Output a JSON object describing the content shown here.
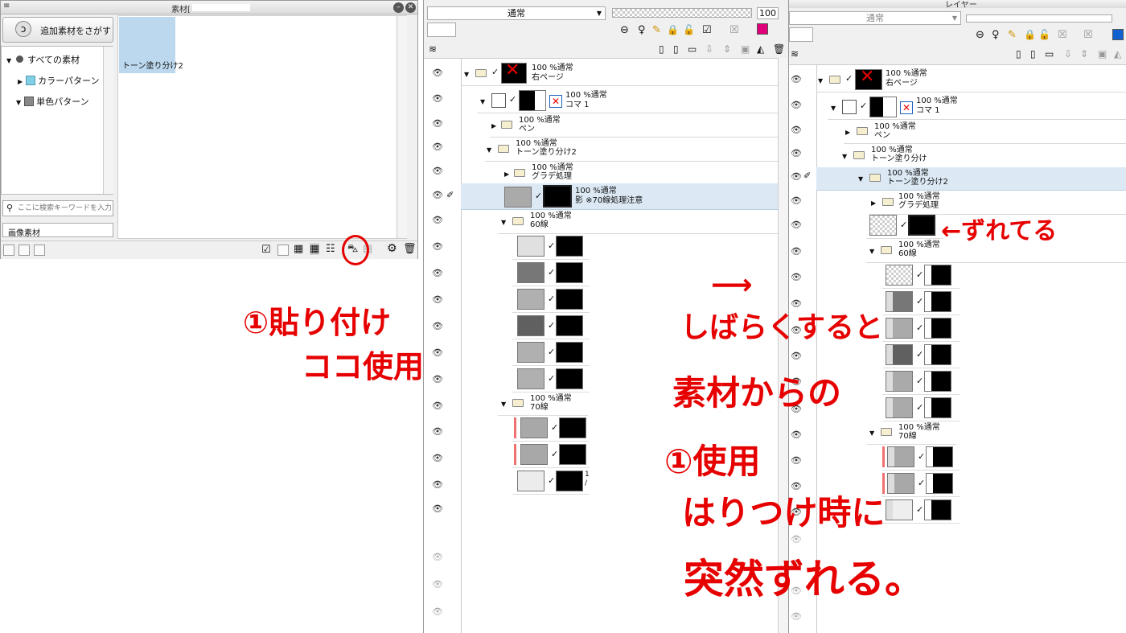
{
  "material_panel": {
    "title": "素材[",
    "add_button": "追加素材をさがす",
    "tree": [
      "すべての素材",
      "カラーパターン",
      "単色パターン"
    ],
    "search_placeholder": "ここに検索キーワードを入力して",
    "category_tab": "画像素材",
    "selected_material": "トーン塗り分け2"
  },
  "middle_panel": {
    "blend_mode": "通常",
    "opacity": "100",
    "layers": [
      {
        "opacity": "100 %通常",
        "name": "右ページ"
      },
      {
        "opacity": "100 %通常",
        "name": "コマ 1"
      },
      {
        "opacity": "100 %通常",
        "name": "ペン"
      },
      {
        "opacity": "100 %通常",
        "name": "トーン塗り分け2"
      },
      {
        "opacity": "100 %通常",
        "name": "グラデ処理"
      },
      {
        "opacity": "100 %通常",
        "name": "影 ※70線処理注意"
      },
      {
        "opacity": "100 %通常",
        "name": "60線"
      },
      {
        "opacity": "100 %通常",
        "name": "70線"
      }
    ],
    "partial_label_1": "1",
    "partial_label_2": "/"
  },
  "right_panel": {
    "title": "レイヤー",
    "blend_mode": "通常",
    "layers": [
      {
        "opacity": "100 %通常",
        "name": "右ページ"
      },
      {
        "opacity": "100 %通常",
        "name": "コマ 1"
      },
      {
        "opacity": "100 %通常",
        "name": "ペン"
      },
      {
        "opacity": "100 %通常",
        "name": "トーン塗り分け"
      },
      {
        "opacity": "100 %通常",
        "name": "トーン塗り分け2"
      },
      {
        "opacity": "100 %通常",
        "name": "グラデ処理"
      },
      {
        "opacity": "100 %通常",
        "name": "60線"
      },
      {
        "opacity": "100 %通常",
        "name": "70線"
      }
    ]
  },
  "annotations": {
    "paste_here_line1": "①貼り付け",
    "paste_here_line2": "ココ使用",
    "shifts": "←ずれてる",
    "after_a_while": "しばらくすると",
    "from_material": "素材からの",
    "use_1": "①使用",
    "when_pasting": "はりつけ時に",
    "suddenly_shifts": "突然ずれる。"
  },
  "colors": {
    "annotation_red": "#e60000",
    "selected_row": "#dce9f5",
    "material_thumb": "#bcd8ee"
  }
}
